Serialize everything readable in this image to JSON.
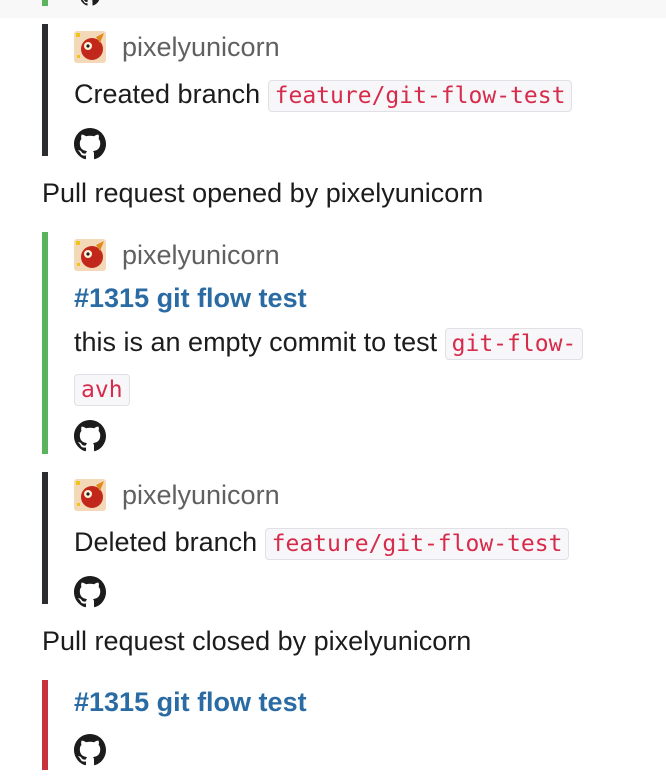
{
  "messages": [
    {
      "author": "pixelyunicorn",
      "text_prefix": "Created branch",
      "branch": "feature/git-flow-test"
    },
    {
      "author": "pixelyunicorn",
      "pr_title": "#1315 git flow test",
      "body_prefix": "this is an empty commit to test",
      "code_part1": "git-flow-",
      "code_part2": "avh"
    },
    {
      "author": "pixelyunicorn",
      "text_prefix": "Deleted branch",
      "branch": "feature/git-flow-test"
    },
    {
      "pr_title": "#1315 git flow test"
    }
  ],
  "events": {
    "opened": "Pull request opened by pixelyunicorn",
    "closed": "Pull request closed by pixelyunicorn"
  },
  "colors": {
    "neutral_bar": "#2c2d30",
    "open_bar": "#5cb35d",
    "closed_bar": "#c8323f",
    "link": "#2a6ba3",
    "code": "#d72b4c"
  },
  "icons": [
    "avatar-icon",
    "github-icon"
  ]
}
